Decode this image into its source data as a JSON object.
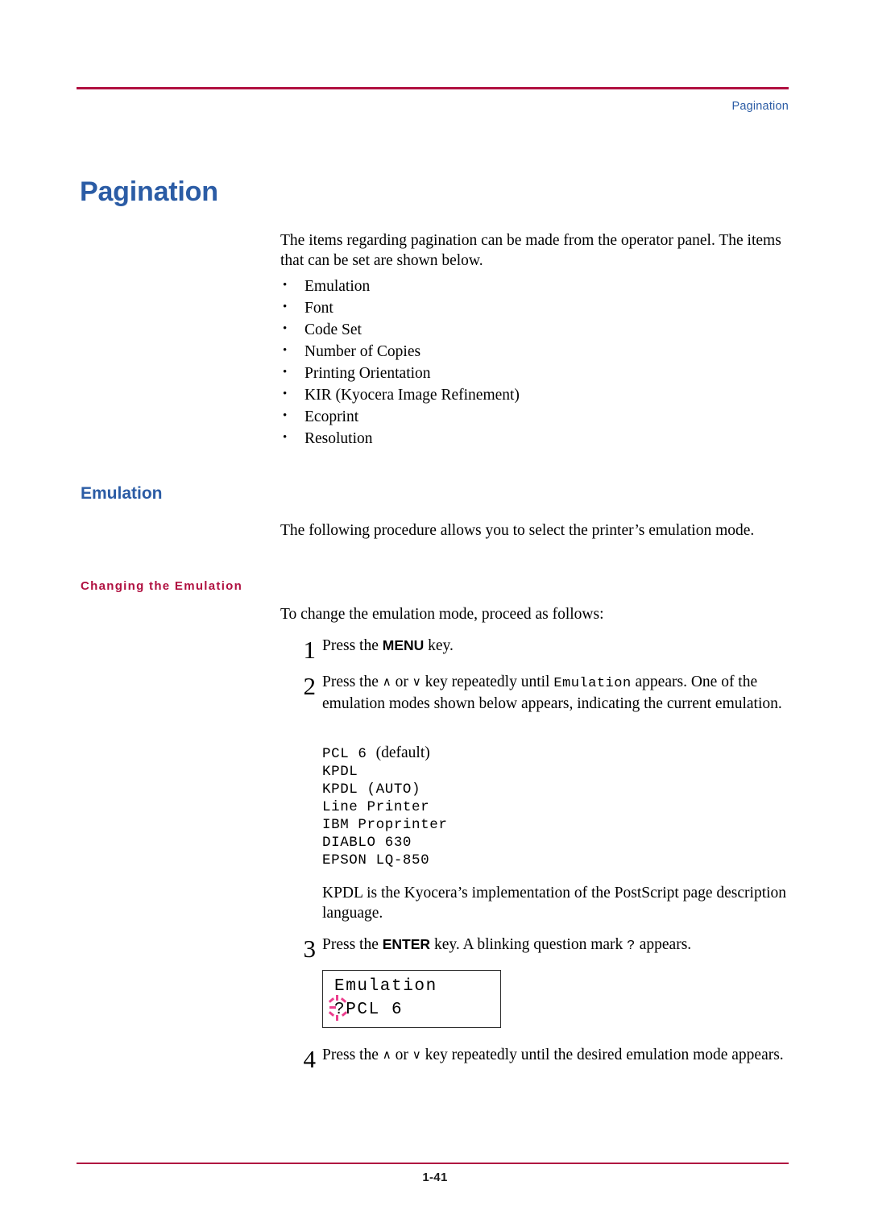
{
  "header": {
    "running_head": "Pagination"
  },
  "footer": {
    "page_number": "1-41"
  },
  "headings": {
    "h1": "Pagination",
    "h2_emulation": "Emulation",
    "h3_changing": "Changing the Emulation"
  },
  "intro": {
    "paragraph": "The items regarding pagination can be made from the operator panel. The items that can be set are shown below.",
    "bullets": [
      "Emulation",
      "Font",
      "Code Set",
      "Number of Copies",
      "Printing Orientation",
      "KIR (Kyocera Image Refinement)",
      "Ecoprint",
      "Resolution"
    ]
  },
  "emulation_section": {
    "intro": "The following procedure allows you to select the printer’s emulation mode.",
    "changing_intro": "To change the emulation mode, proceed as follows:"
  },
  "steps": [
    {
      "number": "1",
      "text_before": "Press the ",
      "key": "MENU",
      "text_after": " key."
    },
    {
      "number": "2",
      "text_before": "Press the ",
      "up_arrow": "∧",
      "or": " or ",
      "down_arrow": "∨",
      "text_mid": " key repeatedly until ",
      "mono_term": "Emulation",
      "text_after": " appears. One of the emulation modes shown below appears, indicating the current emulation."
    },
    {
      "number": "3",
      "text_before": "Press the ",
      "key": "ENTER",
      "text_mid": " key. A blinking question mark ",
      "mono_term": "?",
      "text_after": " appears."
    },
    {
      "number": "4",
      "text_before": "Press the ",
      "up_arrow": "∧",
      "or": " or ",
      "down_arrow": "∨",
      "text_after": " key repeatedly until the desired emulation mode appears."
    }
  ],
  "emulation_modes": {
    "items": [
      "PCL 6",
      "KPDL",
      "KPDL (AUTO)",
      "Line Printer",
      "IBM Proprinter",
      "DIABLO 630",
      "EPSON LQ-850"
    ],
    "default_note": "(default)"
  },
  "kpdl_note": "KPDL is the Kyocera’s implementation of the PostScript page description language.",
  "lcd": {
    "line1": "Emulation",
    "line2": "?PCL 6"
  },
  "colors": {
    "accent_rule": "#b01040",
    "heading_blue": "#2b5ca5",
    "blink_pink": "#ec3f8e"
  }
}
